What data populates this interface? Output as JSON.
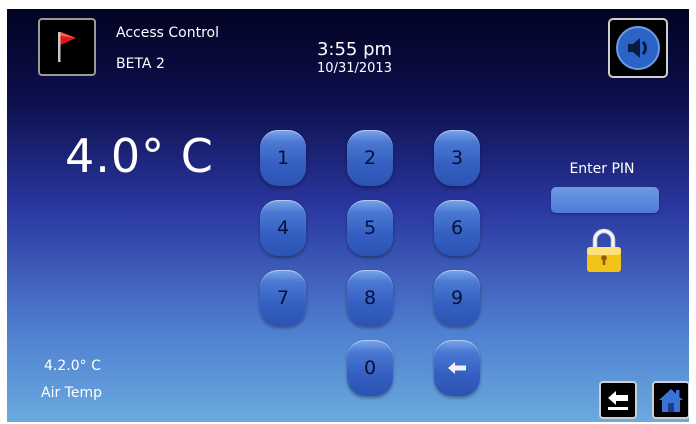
{
  "header": {
    "app_name": "Access Control",
    "unit_name": "BETA 2",
    "time": "3:55 pm",
    "date": "10/31/2013"
  },
  "status": {
    "setpoint_temp": "4.0° C",
    "air_temp_value": "4.2.0° C",
    "air_temp_label": "Air Temp"
  },
  "keypad": {
    "k1": "1",
    "k2": "2",
    "k3": "3",
    "k4": "4",
    "k5": "5",
    "k6": "6",
    "k7": "7",
    "k8": "8",
    "k9": "9",
    "k0": "0"
  },
  "pin": {
    "label": "Enter PIN",
    "value": ""
  },
  "icons": {
    "alarm": "red-flag-icon",
    "sound": "speaker-icon",
    "backspace": "backspace-arrow-icon",
    "back": "back-arrow-icon",
    "home": "home-icon",
    "lock": "padlock-icon"
  },
  "colors": {
    "flag": "#e0161a",
    "sound_button": "#2b63c6",
    "home_button": "#3a72d8",
    "lock_gold": "#f3c219"
  }
}
